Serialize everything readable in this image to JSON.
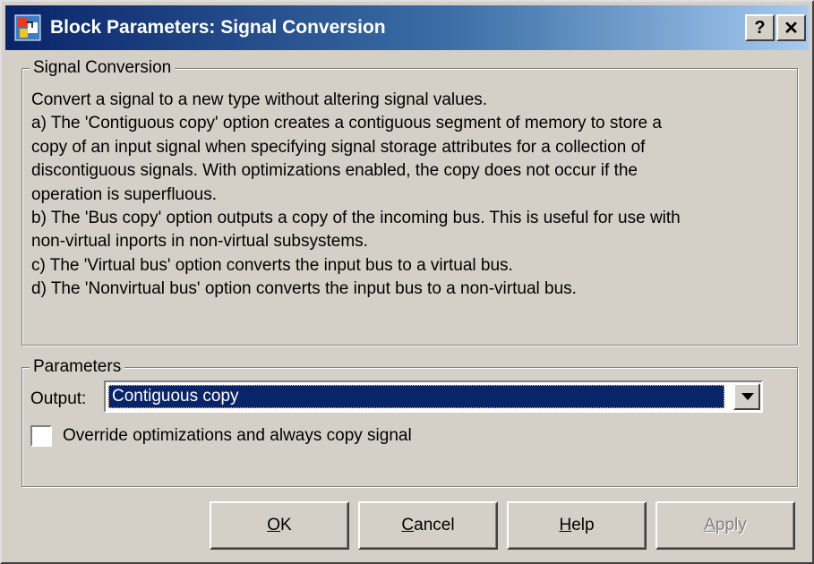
{
  "window": {
    "title": "Block Parameters: Signal Conversion",
    "help_button": "?",
    "close_button": "✕"
  },
  "signal_group": {
    "legend": "Signal Conversion",
    "description_lines": [
      "Convert a signal to a new type without altering signal values.",
      "a) The 'Contiguous copy' option creates a contiguous segment of memory to store a",
      "copy of an input signal when specifying signal storage attributes for a collection of",
      "discontiguous signals.  With optimizations enabled, the copy does not occur if the",
      "operation is superfluous.",
      "b) The 'Bus copy' option outputs a copy of the incoming bus. This is useful for use with",
      "non-virtual inports in non-virtual subsystems.",
      "c) The 'Virtual bus' option converts the input bus to a virtual bus.",
      "d) The 'Nonvirtual bus' option converts the input bus to a non-virtual bus."
    ]
  },
  "parameters_group": {
    "legend": "Parameters",
    "output_label": "Output:",
    "output_value": "Contiguous copy",
    "override_checkbox": {
      "label": "Override optimizations and always copy signal",
      "checked": false
    }
  },
  "buttons": {
    "ok": {
      "mnemonic": "O",
      "rest": "K"
    },
    "cancel": {
      "mnemonic": "C",
      "rest": "ancel"
    },
    "help": {
      "mnemonic": "H",
      "rest": "elp"
    },
    "apply": {
      "mnemonic": "A",
      "rest": "pply",
      "disabled": true
    }
  },
  "colors": {
    "titlebar_start": "#0a246a",
    "titlebar_end": "#a6caf0",
    "face": "#d4d0c8",
    "selection": "#0a246a"
  }
}
